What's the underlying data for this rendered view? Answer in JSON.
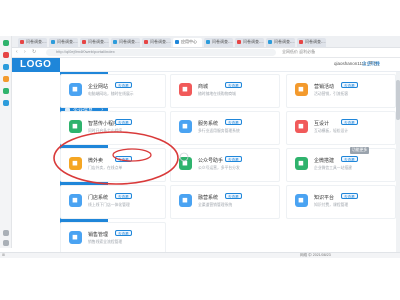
{
  "browser": {
    "tabs": [
      {
        "label": "问卷调查-...",
        "color": "#e64545"
      },
      {
        "label": "问卷调查-...",
        "color": "#2d9cdb"
      },
      {
        "label": "问卷调查-...",
        "color": "#e64545"
      },
      {
        "label": "问卷调查-...",
        "color": "#2d9cdb"
      },
      {
        "label": "问卷调查-...",
        "color": "#e64545"
      },
      {
        "label": "应用中心",
        "color": "#1f86d9"
      },
      {
        "label": "问卷调查-...",
        "color": "#2d9cdb"
      },
      {
        "label": "问卷调查-...",
        "color": "#e64545"
      },
      {
        "label": "问卷调查-...",
        "color": "#2d9cdb"
      },
      {
        "label": "问卷调查-...",
        "color": "#e64545"
      }
    ],
    "address": "http://ql0ej9m4f0web/portal/index",
    "extension_text": "全网低价 返利必备"
  },
  "header": {
    "logo": "LOGO",
    "user": "qiaoshanon1111 [平台]",
    "switch_label": "企业切换"
  },
  "sidebar": {
    "items": [
      {
        "label": "应用中心",
        "arrow": "›"
      },
      {
        "label": "账户服务",
        "arrow": "›"
      },
      {
        "label": "企业信息",
        "arrow": "›"
      },
      {
        "label": "企业账户",
        "arrow": "›"
      },
      {
        "label": "个人信息",
        "arrow": "›"
      }
    ]
  },
  "apps": [
    {
      "title": "企业网站",
      "badge": "去查看",
      "desc": "电脑端网站，随时在线展示",
      "color": "#4aa3f2",
      "glyph": "◼"
    },
    {
      "title": "商城",
      "badge": "去查看",
      "desc": "随时随地在线购物商城",
      "color": "#f15a5a",
      "glyph": "◼"
    },
    {
      "title": "营销活动",
      "badge": "去查看",
      "desc": "活动营销，引流拓客",
      "color": "#f39a2d",
      "glyph": "◼"
    },
    {
      "title": "智慧传小程序",
      "badge": "去查看",
      "desc": "同时开启多个小程序",
      "color": "#2fb36d",
      "glyph": "◼"
    },
    {
      "title": "服务系统",
      "badge": "去查看",
      "desc": "多行业适用服务管理系统",
      "color": "#4aa3f2",
      "glyph": "◼"
    },
    {
      "title": "互设计",
      "badge": "去查看",
      "desc": "互动模板，轻松设计",
      "color": "#f15a5a",
      "glyph": "◼"
    },
    {
      "title": "微外卖",
      "badge": "去查看",
      "desc": "门店外卖，在线点单",
      "color": "#f5a623",
      "glyph": "◼"
    },
    {
      "title": "公众号助手",
      "badge": "去查看",
      "desc": "公众号运营，多平台分发",
      "color": "#2fb36d",
      "glyph": "◼"
    },
    {
      "title": "企微搭建",
      "badge": "去查看",
      "desc": "企业微信工具一站搭建",
      "color": "#2fb36d",
      "glyph": "◼"
    },
    {
      "title": "门店系统",
      "badge": "去查看",
      "desc": "线上线下门店一体化管理",
      "color": "#4aa3f2",
      "glyph": "◼"
    },
    {
      "title": "融营系统",
      "badge": "去查看",
      "desc": "全渠道营销管理系统",
      "color": "#4aa3f2",
      "glyph": "◼"
    },
    {
      "title": "知识平台",
      "badge": "去查看",
      "desc": "知识付费，课程管理",
      "color": "#4aa3f2",
      "glyph": "◼"
    },
    {
      "title": "销售管理",
      "badge": "去查看",
      "desc": "销售线索全流程管理",
      "color": "#4aa3f2",
      "glyph": "◼"
    }
  ],
  "corner_badge": "功能更多",
  "taskbar": {
    "left": "⊞",
    "right": "网络  中  2021/08/23"
  }
}
